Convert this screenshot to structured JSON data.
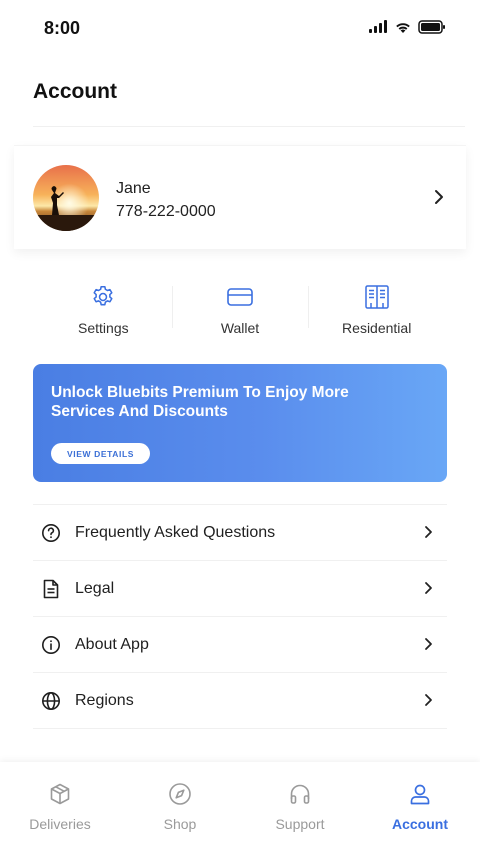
{
  "status_bar": {
    "time": "8:00"
  },
  "header": {
    "title": "Account"
  },
  "profile": {
    "name": "Jane",
    "phone": "778-222-0000"
  },
  "quick_actions": [
    {
      "label": "Settings",
      "icon": "gear-icon"
    },
    {
      "label": "Wallet",
      "icon": "card-icon"
    },
    {
      "label": "Residential",
      "icon": "building-icon"
    }
  ],
  "promo": {
    "title": "Unlock Bluebits Premium To Enjoy More Services And Discounts",
    "button_label": "VIEW DETAILS"
  },
  "menu": [
    {
      "label": "Frequently Asked Questions",
      "icon": "question-icon"
    },
    {
      "label": "Legal",
      "icon": "document-icon"
    },
    {
      "label": "About App",
      "icon": "info-icon"
    },
    {
      "label": "Regions",
      "icon": "globe-icon"
    }
  ],
  "tabs": [
    {
      "label": "Deliveries",
      "icon": "box-icon",
      "active": false
    },
    {
      "label": "Shop",
      "icon": "compass-icon",
      "active": false
    },
    {
      "label": "Support",
      "icon": "headphones-icon",
      "active": false
    },
    {
      "label": "Account",
      "icon": "user-icon",
      "active": true
    }
  ],
  "colors": {
    "accent": "#3a6fe0",
    "promo_start": "#4a7ee3",
    "promo_end": "#69a7f6",
    "inactive": "#9a9a9a"
  }
}
